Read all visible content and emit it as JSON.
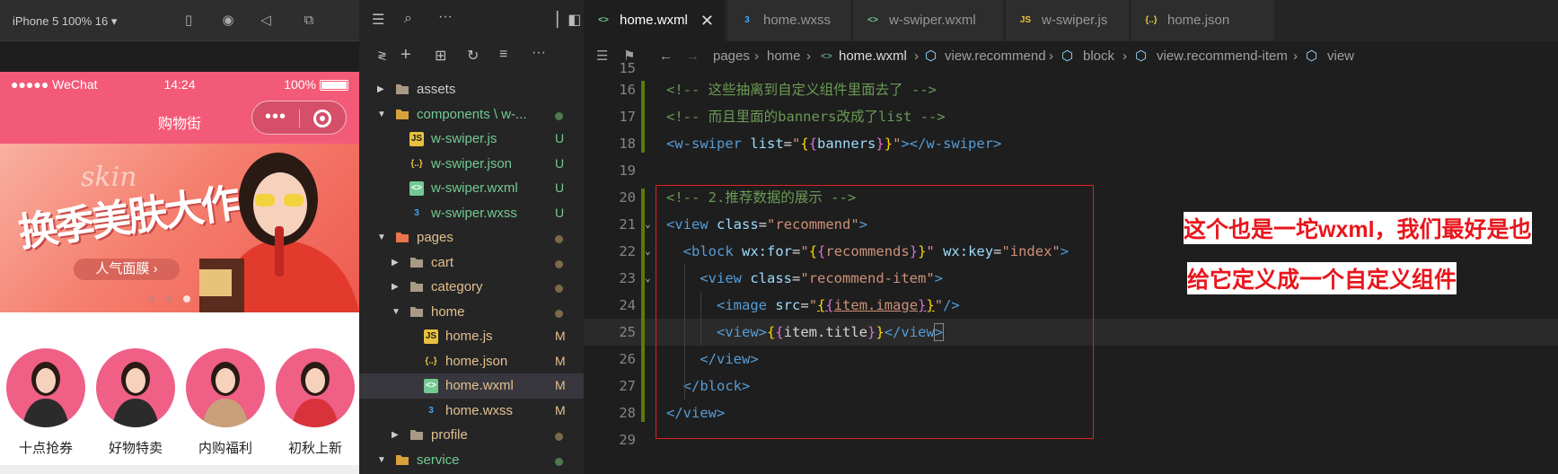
{
  "simulator": {
    "device_label": "iPhone 5 100% 16 ▾",
    "status_carrier": "●●●●● WeChat",
    "status_time": "14:24",
    "status_battery": "100%",
    "nav_title": "购物街",
    "banner": {
      "script_text": "skin",
      "headline": "换季美肤大作战",
      "pill": "人气面膜 ›"
    },
    "recommends": [
      {
        "label": "十点抢券"
      },
      {
        "label": "好物特卖"
      },
      {
        "label": "内购福利"
      },
      {
        "label": "初秋上新"
      }
    ]
  },
  "explorer": {
    "tree": [
      {
        "label": "assets",
        "icon": "folder-icon",
        "badge": "",
        "badge_type": ""
      },
      {
        "label": "components \\ w-...",
        "icon": "folder-icon",
        "badge": "",
        "badge_type": "dot-green"
      },
      {
        "label": "w-swiper.js",
        "icon": "js-file-icon",
        "badge": "U",
        "badge_type": "green"
      },
      {
        "label": "w-swiper.json",
        "icon": "json-file-icon",
        "badge": "U",
        "badge_type": "green"
      },
      {
        "label": "w-swiper.wxml",
        "icon": "wxml-file-icon",
        "badge": "U",
        "badge_type": "green"
      },
      {
        "label": "w-swiper.wxss",
        "icon": "wxss-file-icon",
        "badge": "U",
        "badge_type": "green"
      },
      {
        "label": "pages",
        "icon": "folder-icon",
        "badge": "",
        "badge_type": "dot-orange"
      },
      {
        "label": "cart",
        "icon": "folder-icon",
        "badge": "",
        "badge_type": "dot-orange"
      },
      {
        "label": "category",
        "icon": "folder-icon",
        "badge": "",
        "badge_type": "dot-orange"
      },
      {
        "label": "home",
        "icon": "folder-icon",
        "badge": "",
        "badge_type": "dot-orange"
      },
      {
        "label": "home.js",
        "icon": "js-file-icon",
        "badge": "M",
        "badge_type": "orange"
      },
      {
        "label": "home.json",
        "icon": "json-file-icon",
        "badge": "M",
        "badge_type": "orange"
      },
      {
        "label": "home.wxml",
        "icon": "wxml-file-icon",
        "badge": "M",
        "badge_type": "orange"
      },
      {
        "label": "home.wxss",
        "icon": "wxss-file-icon",
        "badge": "M",
        "badge_type": "orange"
      },
      {
        "label": "profile",
        "icon": "folder-icon",
        "badge": "",
        "badge_type": "dot-orange"
      },
      {
        "label": "service",
        "icon": "folder-icon",
        "badge": "",
        "badge_type": "dot-green"
      }
    ]
  },
  "editor": {
    "tabs": [
      {
        "label": "home.wxml",
        "icon": "wxml-file-icon"
      },
      {
        "label": "home.wxss",
        "icon": "wxss-file-icon"
      },
      {
        "label": "w-swiper.wxml",
        "icon": "wxml-file-icon"
      },
      {
        "label": "w-swiper.js",
        "icon": "js-file-icon"
      },
      {
        "label": "home.json",
        "icon": "json-file-icon"
      }
    ],
    "tab_close": "✕",
    "breadcrumbs": [
      "pages",
      "home",
      "home.wxml",
      "view.recommend",
      "block",
      "view.recommend-item",
      "view"
    ],
    "line_numbers": [
      "15",
      "16",
      "17",
      "18",
      "19",
      "20",
      "21",
      "22",
      "23",
      "24",
      "25",
      "26",
      "27",
      "28",
      "29"
    ]
  },
  "annotation": {
    "line1": "这个也是一坨wxml，我们最好是也",
    "line2": "给它定义成一个自定义组件"
  },
  "colors": {
    "nav_pink": "#f35a77",
    "annotation_red": "#e8161c",
    "git_green": "#73c991",
    "git_orange": "#e2c08d"
  }
}
